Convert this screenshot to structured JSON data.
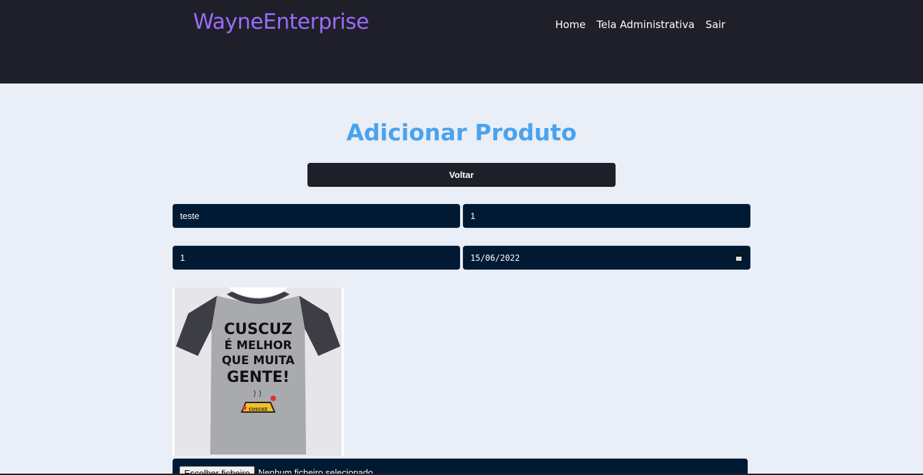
{
  "header": {
    "brand": "WayneEnterprise",
    "nav": [
      "Home",
      "Tela Administrativa",
      "Sair"
    ]
  },
  "main": {
    "title": "Adicionar Produto",
    "back_label": "Voltar",
    "fields": {
      "name_value": "teste",
      "field2_value": "1",
      "field3_value": "1",
      "date_value": "15/06/2022"
    },
    "image": {
      "lines": [
        "CUSCUZ",
        "É MELHOR",
        "QUE MUITA",
        "GENTE!"
      ],
      "badge": "CUSCUZ"
    },
    "file": {
      "button_label": "Escolher ficheiro",
      "status": "Nenhum ficheiro selecionado"
    }
  }
}
